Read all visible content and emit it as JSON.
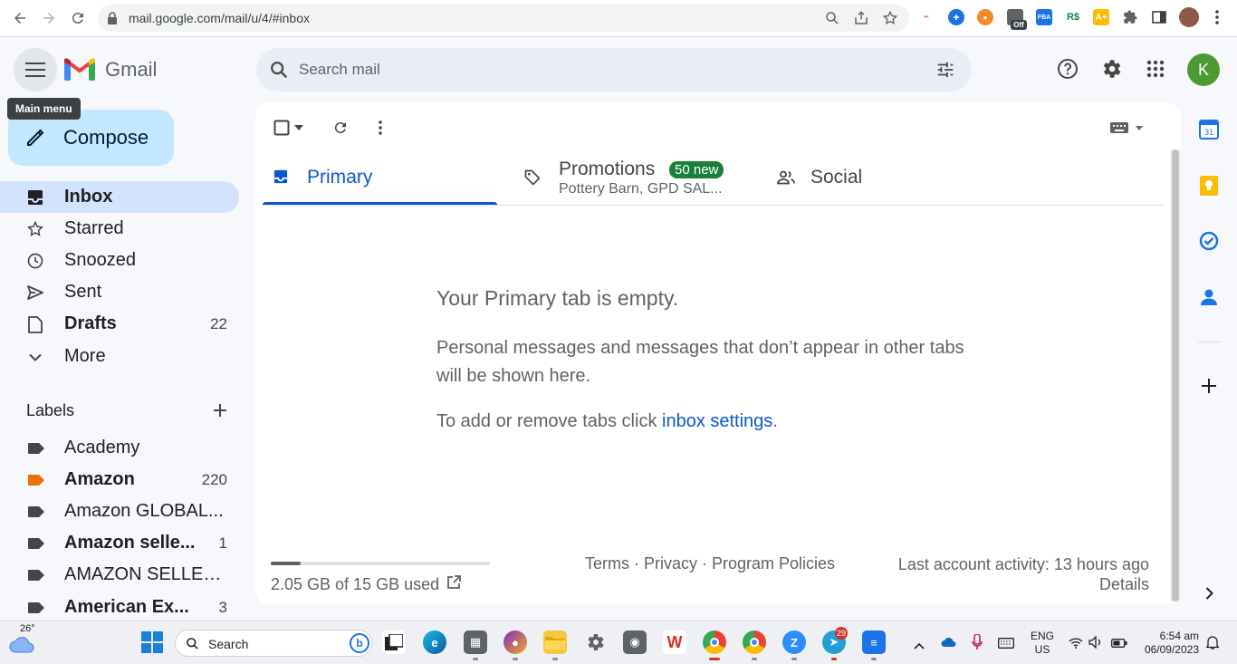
{
  "browser": {
    "url": "mail.google.com/mail/u/4/#inbox",
    "ext_off_badge": "Off"
  },
  "header": {
    "menu_tooltip": "Main menu",
    "logo_text": "Gmail",
    "search_placeholder": "Search mail",
    "avatar_initial": "K",
    "avatar_color": "#4d9a32"
  },
  "sidebar": {
    "compose_label": "Compose",
    "items": [
      {
        "label": "Inbox",
        "count": "",
        "bold": true,
        "icon": "inbox-icon",
        "active": true
      },
      {
        "label": "Starred",
        "count": "",
        "bold": false,
        "icon": "star-icon"
      },
      {
        "label": "Snoozed",
        "count": "",
        "bold": false,
        "icon": "clock-icon"
      },
      {
        "label": "Sent",
        "count": "",
        "bold": false,
        "icon": "send-icon"
      },
      {
        "label": "Drafts",
        "count": "22",
        "bold": true,
        "icon": "draft-icon"
      },
      {
        "label": "More",
        "count": "",
        "bold": false,
        "icon": "chevron-down-icon"
      }
    ],
    "labels_heading": "Labels",
    "labels": [
      {
        "label": "Academy",
        "count": "",
        "bold": false,
        "color": "#444746"
      },
      {
        "label": "Amazon",
        "count": "220",
        "bold": true,
        "color": "#e8710a"
      },
      {
        "label": "Amazon GLOBAL...",
        "count": "",
        "bold": false,
        "color": "#444746"
      },
      {
        "label": "Amazon selle...",
        "count": "1",
        "bold": true,
        "color": "#444746"
      },
      {
        "label": "AMAZON SELLER...",
        "count": "",
        "bold": false,
        "color": "#444746"
      },
      {
        "label": "American Ex...",
        "count": "3",
        "bold": true,
        "color": "#444746"
      }
    ]
  },
  "tabs": {
    "primary": "Primary",
    "promotions": "Promotions",
    "promotions_badge": "50 new",
    "promotions_senders": "Pottery Barn, GPD SAL...",
    "social": "Social"
  },
  "empty_state": {
    "title": "Your Primary tab is empty.",
    "description": "Personal messages and messages that don’t appear in other tabs will be shown here.",
    "settings_prefix": "To add or remove tabs click ",
    "settings_link": "inbox settings",
    "settings_suffix": "."
  },
  "footer": {
    "storage_text": "2.05 GB of 15 GB used",
    "storage_fraction": 0.137,
    "links": "Terms · Privacy · Program Policies",
    "last_activity": "Last account activity: 13 hours ago",
    "details": "Details"
  },
  "taskbar": {
    "weather_temp": "26°",
    "search_label": "Search",
    "telegram_badge": "29",
    "lang_line1": "ENG",
    "lang_line2": "US",
    "time": "6:54 am",
    "date": "06/09/2023"
  }
}
